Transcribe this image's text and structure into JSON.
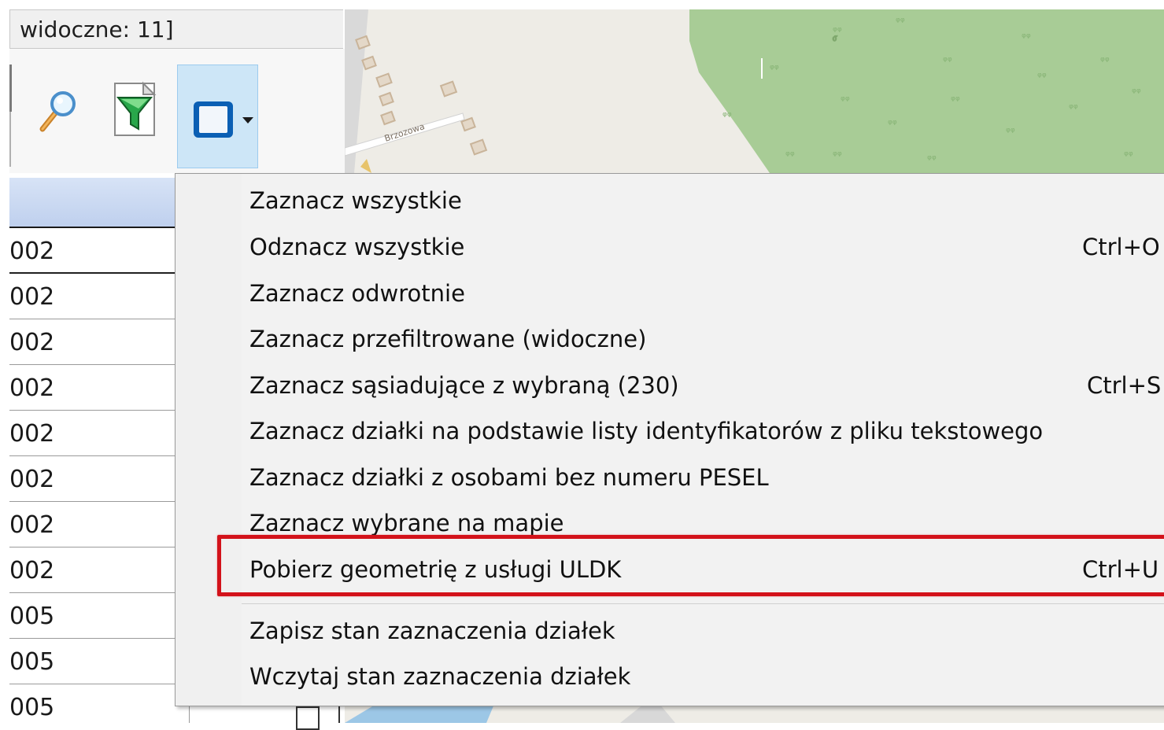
{
  "window": {
    "title_fragment": "widoczne: 11]"
  },
  "toolbar": {
    "search_icon": "magnifier-icon",
    "filter_icon": "filter-icon",
    "select_icon": "selection-rectangle-icon",
    "dropdown_icon": "dropdown-arrow-icon"
  },
  "grid": {
    "rows": [
      "002",
      "002",
      "002",
      "002",
      "002",
      "002",
      "002",
      "002",
      "005",
      "005",
      "005"
    ]
  },
  "map": {
    "street_label": "Brzozowa"
  },
  "menu": {
    "items": [
      {
        "label": "Zaznacz wszystkie",
        "shortcut": ""
      },
      {
        "label": "Odznacz wszystkie",
        "shortcut": "Ctrl+O"
      },
      {
        "label": "Zaznacz odwrotnie",
        "shortcut": ""
      },
      {
        "label": "Zaznacz przefiltrowane (widoczne)",
        "shortcut": ""
      },
      {
        "label": "Zaznacz sąsiadujące z wybraną (230)",
        "shortcut": "Ctrl+S"
      },
      {
        "label": "Zaznacz działki na podstawie listy identyfikatorów z pliku tekstowego",
        "shortcut": ""
      },
      {
        "label": "Zaznacz działki z osobami bez numeru PESEL",
        "shortcut": ""
      },
      {
        "label": "Zaznacz wybrane na mapie",
        "shortcut": ""
      },
      {
        "label": "Pobierz geometrię z usługi ULDK",
        "shortcut": "Ctrl+U"
      },
      {
        "label": "Zapisz stan zaznaczenia działek",
        "shortcut": ""
      },
      {
        "label": "Wczytaj stan zaznaczenia działek",
        "shortcut": ""
      }
    ]
  },
  "colors": {
    "highlight": "#d3121a",
    "forest": "#a8cc96",
    "selected_button": "#cde6f7"
  }
}
